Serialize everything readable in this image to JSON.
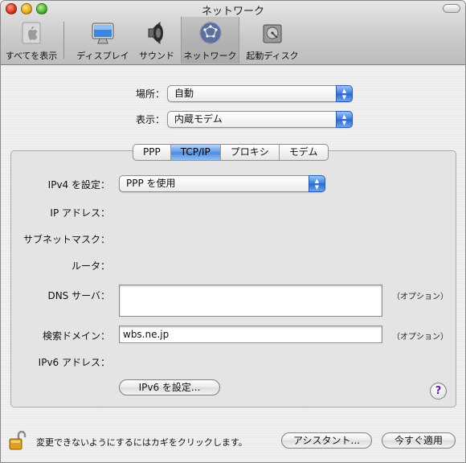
{
  "window": {
    "title": "ネットワーク"
  },
  "toolbar": {
    "show_all": "すべてを表示",
    "items": [
      {
        "label": "ディスプレイ",
        "icon": "display-icon"
      },
      {
        "label": "サウンド",
        "icon": "speaker-icon"
      },
      {
        "label": "ネットワーク",
        "icon": "network-globe-icon",
        "selected": true
      },
      {
        "label": "起動ディスク",
        "icon": "startup-disk-icon"
      }
    ]
  },
  "location": {
    "label": "場所：",
    "value": "自動"
  },
  "show": {
    "label": "表示：",
    "value": "内蔵モデム"
  },
  "tabs": [
    "PPP",
    "TCP/IP",
    "プロキシ",
    "モデム"
  ],
  "active_tab": "TCP/IP",
  "tcpip": {
    "ipv4_label": "IPv4 を設定：",
    "ipv4_value": "PPP を使用",
    "ip_address_label": "IP アドレス：",
    "subnet_label": "サブネットマスク：",
    "router_label": "ルータ：",
    "dns_label": "DNS サーバ：",
    "dns_value": "",
    "dns_note": "（オプション）",
    "search_domain_label": "検索ドメイン：",
    "search_domain_value": "wbs.ne.jp",
    "search_domain_note": "（オプション）",
    "ipv6_label": "IPv6 アドレス：",
    "ipv6_button": "IPv6 を設定..."
  },
  "help": "?",
  "footer": {
    "lock_text": "変更できないようにするにはカギをクリックします。",
    "assistant_button": "アシスタント...",
    "apply_button": "今すぐ適用"
  },
  "colors": {
    "accent": "#3a7bd6",
    "tab_active": "#5b9ae8"
  }
}
